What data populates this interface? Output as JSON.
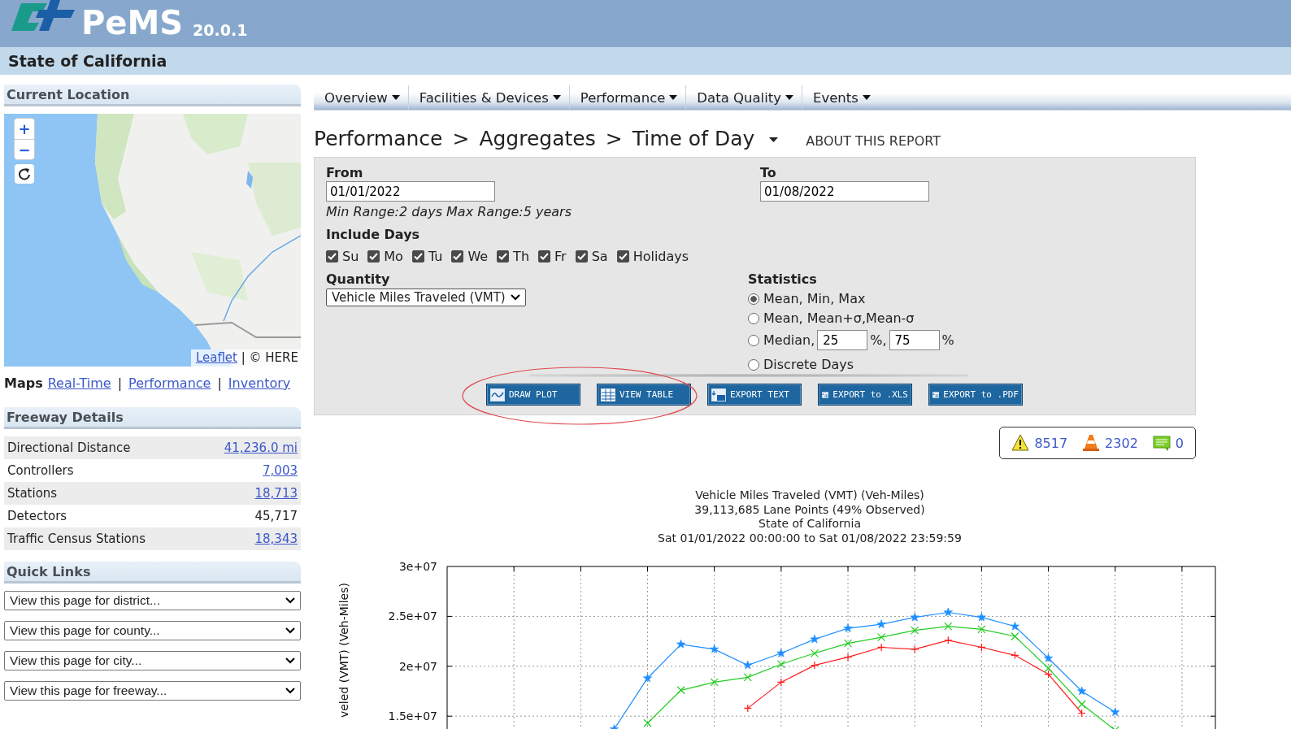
{
  "header": {
    "logo_text": "PeMS",
    "version": "20.0.1",
    "subtitle": "State of California"
  },
  "sidebar": {
    "location": {
      "title": "Current Location",
      "map": {
        "kind": "picture",
        "zoom_in": "+",
        "zoom_out": "−",
        "attribution_link": "Leaflet",
        "attribution_text": "| © HERE"
      }
    },
    "maps_links": {
      "label": "Maps",
      "separator": "|",
      "links": [
        "Real-Time",
        "Performance",
        "Inventory"
      ]
    },
    "freeway_details": {
      "title": "Freeway Details",
      "rows": [
        {
          "label": "Directional Distance",
          "value": "41,236.0 mi",
          "linked": true
        },
        {
          "label": "Controllers",
          "value": "7,003",
          "linked": true
        },
        {
          "label": "Stations",
          "value": "18,713",
          "linked": true
        },
        {
          "label": "Detectors",
          "value": "45,717",
          "linked": false
        },
        {
          "label": "Traffic Census Stations",
          "value": "18,343",
          "linked": true
        }
      ]
    },
    "quick_links": {
      "title": "Quick Links",
      "selects": [
        "View this page for district...",
        "View this page for county...",
        "View this page for city...",
        "View this page for freeway..."
      ]
    }
  },
  "nav": {
    "menus": [
      "Overview",
      "Facilities & Devices",
      "Performance",
      "Data Quality",
      "Events"
    ]
  },
  "breadcrumb": {
    "items": [
      "Performance",
      "Aggregates",
      "Time of Day"
    ],
    "separator": ">",
    "about_link": "ABOUT THIS REPORT"
  },
  "form": {
    "from": {
      "label": "From",
      "value": "01/01/2022"
    },
    "to": {
      "label": "To",
      "value": "01/08/2022"
    },
    "range_note": "Min Range:2 days Max Range:5 years",
    "include_days": {
      "label": "Include Days",
      "days": [
        {
          "label": "Su",
          "checked": true
        },
        {
          "label": "Mo",
          "checked": true
        },
        {
          "label": "Tu",
          "checked": true
        },
        {
          "label": "We",
          "checked": true
        },
        {
          "label": "Th",
          "checked": true
        },
        {
          "label": "Fr",
          "checked": true
        },
        {
          "label": "Sa",
          "checked": true
        },
        {
          "label": "Holidays",
          "checked": true
        }
      ]
    },
    "quantity": {
      "label": "Quantity",
      "value": "Vehicle Miles Traveled (VMT)"
    },
    "statistics": {
      "label": "Statistics",
      "options": [
        {
          "kind": "plain",
          "label": "Mean, Min, Max",
          "selected": true
        },
        {
          "kind": "plain",
          "label": "Mean, Mean+σ,Mean-σ",
          "selected": false
        },
        {
          "kind": "median",
          "label": "Median,",
          "low": "25",
          "middle": "%,",
          "high": "75",
          "suffix": "%",
          "selected": false
        },
        {
          "kind": "plain",
          "label": "Discrete Days",
          "selected": false
        }
      ]
    },
    "buttons": [
      {
        "kind": "plot",
        "label": "DRAW PLOT"
      },
      {
        "kind": "table",
        "label": "VIEW TABLE"
      },
      {
        "kind": "text",
        "label": "EXPORT TEXT"
      },
      {
        "kind": "sheet",
        "label": "EXPORT to .XLS"
      },
      {
        "kind": "sheet",
        "label": "EXPORT to .PDF"
      }
    ]
  },
  "badges": [
    {
      "kind": "warning",
      "count": "8517"
    },
    {
      "kind": "cone",
      "count": "2302"
    },
    {
      "kind": "note",
      "count": "0"
    }
  ],
  "chart": {
    "title_lines": [
      "Vehicle Miles Traveled (VMT) (Veh-Miles)",
      "39,113,685 Lane Points (49% Observed)",
      "State of California",
      "Sat 01/01/2022 00:00:00 to Sat 01/08/2022 23:59:59"
    ],
    "chart_data": {
      "type": "line",
      "ylabel": "veled (VMT) (Veh-Miles)",
      "categories": [
        null,
        null,
        null,
        null,
        null,
        null,
        null,
        null,
        null,
        null,
        null,
        null,
        null,
        null,
        null,
        null,
        null,
        null,
        null,
        null,
        null,
        null,
        null,
        null
      ],
      "ylim": [
        13300000,
        30000000
      ],
      "grid": true,
      "yticks": [
        {
          "value": 15000000,
          "label": "1.5e+07"
        },
        {
          "value": 20000000,
          "label": "2e+07"
        },
        {
          "value": 25000000,
          "label": "2.5e+07"
        },
        {
          "value": 30000000,
          "label": "3e+07"
        }
      ],
      "series": [
        {
          "color": "#1e8fff",
          "marker": "star",
          "values": [
            null,
            null,
            null,
            null,
            null,
            13700000,
            18800000,
            22200000,
            21700000,
            20100000,
            21300000,
            22700000,
            23800000,
            24200000,
            24900000,
            25400000,
            24900000,
            24000000,
            20800000,
            17500000,
            15400000,
            null,
            null,
            null
          ]
        },
        {
          "color": "#22cc22",
          "marker": "x",
          "values": [
            null,
            null,
            null,
            null,
            null,
            null,
            14300000,
            17600000,
            18400000,
            18900000,
            20200000,
            21300000,
            22300000,
            22900000,
            23600000,
            24000000,
            23700000,
            23000000,
            19800000,
            16200000,
            13600000,
            null,
            null,
            null
          ]
        },
        {
          "color": "#ff1a1a",
          "marker": "plus",
          "values": [
            null,
            null,
            null,
            null,
            null,
            null,
            null,
            null,
            null,
            15800000,
            18400000,
            20100000,
            20900000,
            21900000,
            21700000,
            22600000,
            21900000,
            21100000,
            19200000,
            15300000,
            null,
            null,
            null,
            null
          ]
        }
      ]
    }
  }
}
